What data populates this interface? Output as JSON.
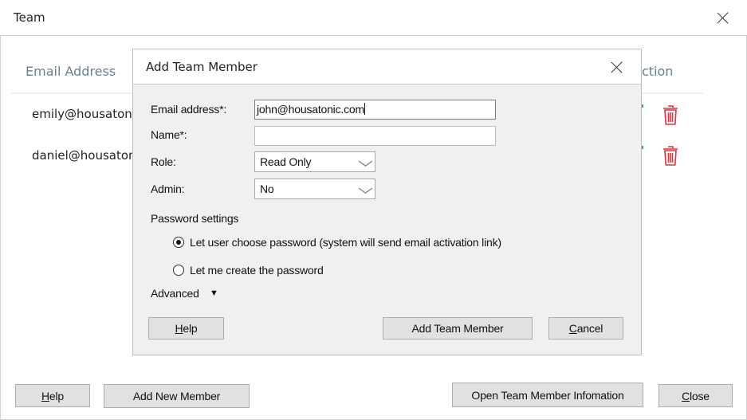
{
  "window": {
    "title": "Team",
    "close_icon": "close-icon"
  },
  "table": {
    "columns": [
      "Email Address",
      "Action"
    ],
    "visible_column_fragments": {
      "email": "Email Address",
      "action": "ction"
    },
    "rows": [
      {
        "email": "emily@housatoni",
        "action_icon": "trash-icon"
      },
      {
        "email": "daniel@housaton",
        "action_icon": "trash-icon"
      }
    ]
  },
  "footer": {
    "help_label_prefix": "H",
    "help_label_rest": "elp",
    "add_new_member_label": "Add New Member",
    "open_info_label": "Open Team Member Infomation",
    "close_label_prefix": "C",
    "close_label_rest": "lose"
  },
  "dialog": {
    "title": "Add Team Member",
    "fields": {
      "email_label": "Email address*:",
      "email_value": "john@housatonic.com",
      "name_label": "Name*:",
      "name_value": "",
      "role_label": "Role:",
      "role_value": "Read Only",
      "admin_label": "Admin:",
      "admin_value": "No"
    },
    "password": {
      "section_label": "Password settings",
      "options": [
        {
          "label": "Let user choose password (system will send email activation link)",
          "selected": true
        },
        {
          "label": "Let me create the password",
          "selected": false
        }
      ]
    },
    "advanced_label": "Advanced",
    "advanced_icon": "▼",
    "buttons": {
      "help_prefix": "H",
      "help_rest": "elp",
      "add_label": "Add Team Member",
      "cancel_prefix": "C",
      "cancel_rest": "ancel"
    }
  },
  "colors": {
    "accent_focus": "#3c8ddc",
    "delete_red": "#d9363e",
    "header_text": "#6b7f95"
  }
}
